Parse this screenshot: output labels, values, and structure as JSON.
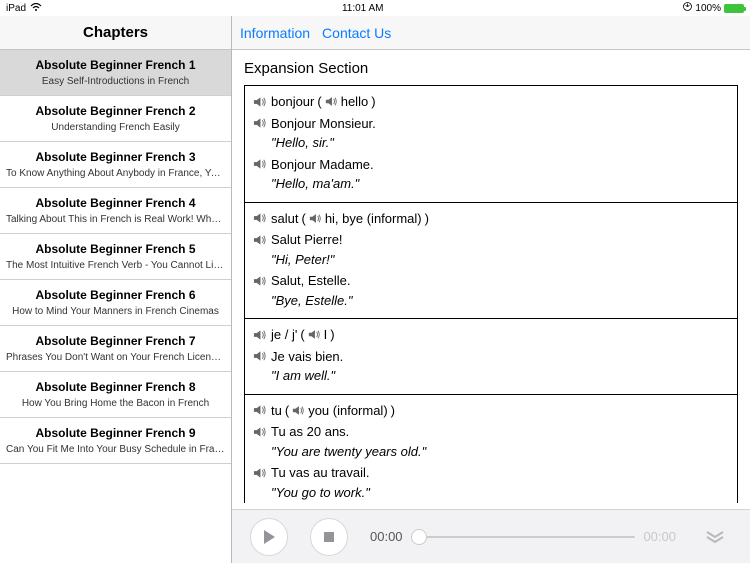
{
  "statusbar": {
    "device": "iPad",
    "time": "11:01 AM",
    "battery": "100%"
  },
  "sidebar": {
    "header": "Chapters",
    "items": [
      {
        "title": "Absolute Beginner French 1",
        "subtitle": "Easy Self-Introductions in French"
      },
      {
        "title": "Absolute Beginner French 2",
        "subtitle": "Understanding French Easily"
      },
      {
        "title": "Absolute Beginner French 3",
        "subtitle": "To Know Anything About Anybody in France, You HAVE to St..."
      },
      {
        "title": "Absolute Beginner French 4",
        "subtitle": "Talking About This in French is Real Work! What Do You Do?"
      },
      {
        "title": "Absolute Beginner French 5",
        "subtitle": "The Most Intuitive French Verb - You Cannot Live Without it!!"
      },
      {
        "title": "Absolute Beginner French 6",
        "subtitle": "How to Mind Your Manners in French Cinemas"
      },
      {
        "title": "Absolute Beginner French 7",
        "subtitle": "Phrases You Don't Want on Your French License Plate"
      },
      {
        "title": "Absolute Beginner French 8",
        "subtitle": "How You Bring Home the Bacon in French"
      },
      {
        "title": "Absolute Beginner French 9",
        "subtitle": "Can You Fit Me Into Your Busy Schedule in France?"
      }
    ]
  },
  "topnav": {
    "link1": "Information",
    "link2": "Contact Us"
  },
  "section": {
    "title": "Expansion Section",
    "groups": [
      {
        "word": "bonjour",
        "open": "(",
        "gloss": "hello",
        "close": ")",
        "ex": [
          {
            "fr": "Bonjour Monsieur.",
            "en": "\"Hello, sir.\""
          },
          {
            "fr": "Bonjour Madame.",
            "en": "\"Hello, ma'am.\""
          }
        ]
      },
      {
        "word": "salut",
        "open": "(",
        "gloss": "hi, bye (informal)",
        "close": ")",
        "ex": [
          {
            "fr": "Salut Pierre!",
            "en": "\"Hi, Peter!\""
          },
          {
            "fr": "Salut, Estelle.",
            "en": "\"Bye, Estelle.\""
          }
        ]
      },
      {
        "word": "je / j'",
        "open": "(",
        "gloss": "I",
        "close": ")",
        "ex": [
          {
            "fr": "Je vais bien.",
            "en": "\"I am well.\""
          }
        ]
      },
      {
        "word": "tu",
        "open": "(",
        "gloss": "you (informal)",
        "close": ")",
        "ex": [
          {
            "fr": "Tu as 20 ans.",
            "en": "\"You are twenty years old.\""
          },
          {
            "fr": "Tu vas au travail.",
            "en": "\"You go to work.\""
          }
        ]
      }
    ]
  },
  "player": {
    "current": "00:00",
    "duration": "00:00"
  }
}
